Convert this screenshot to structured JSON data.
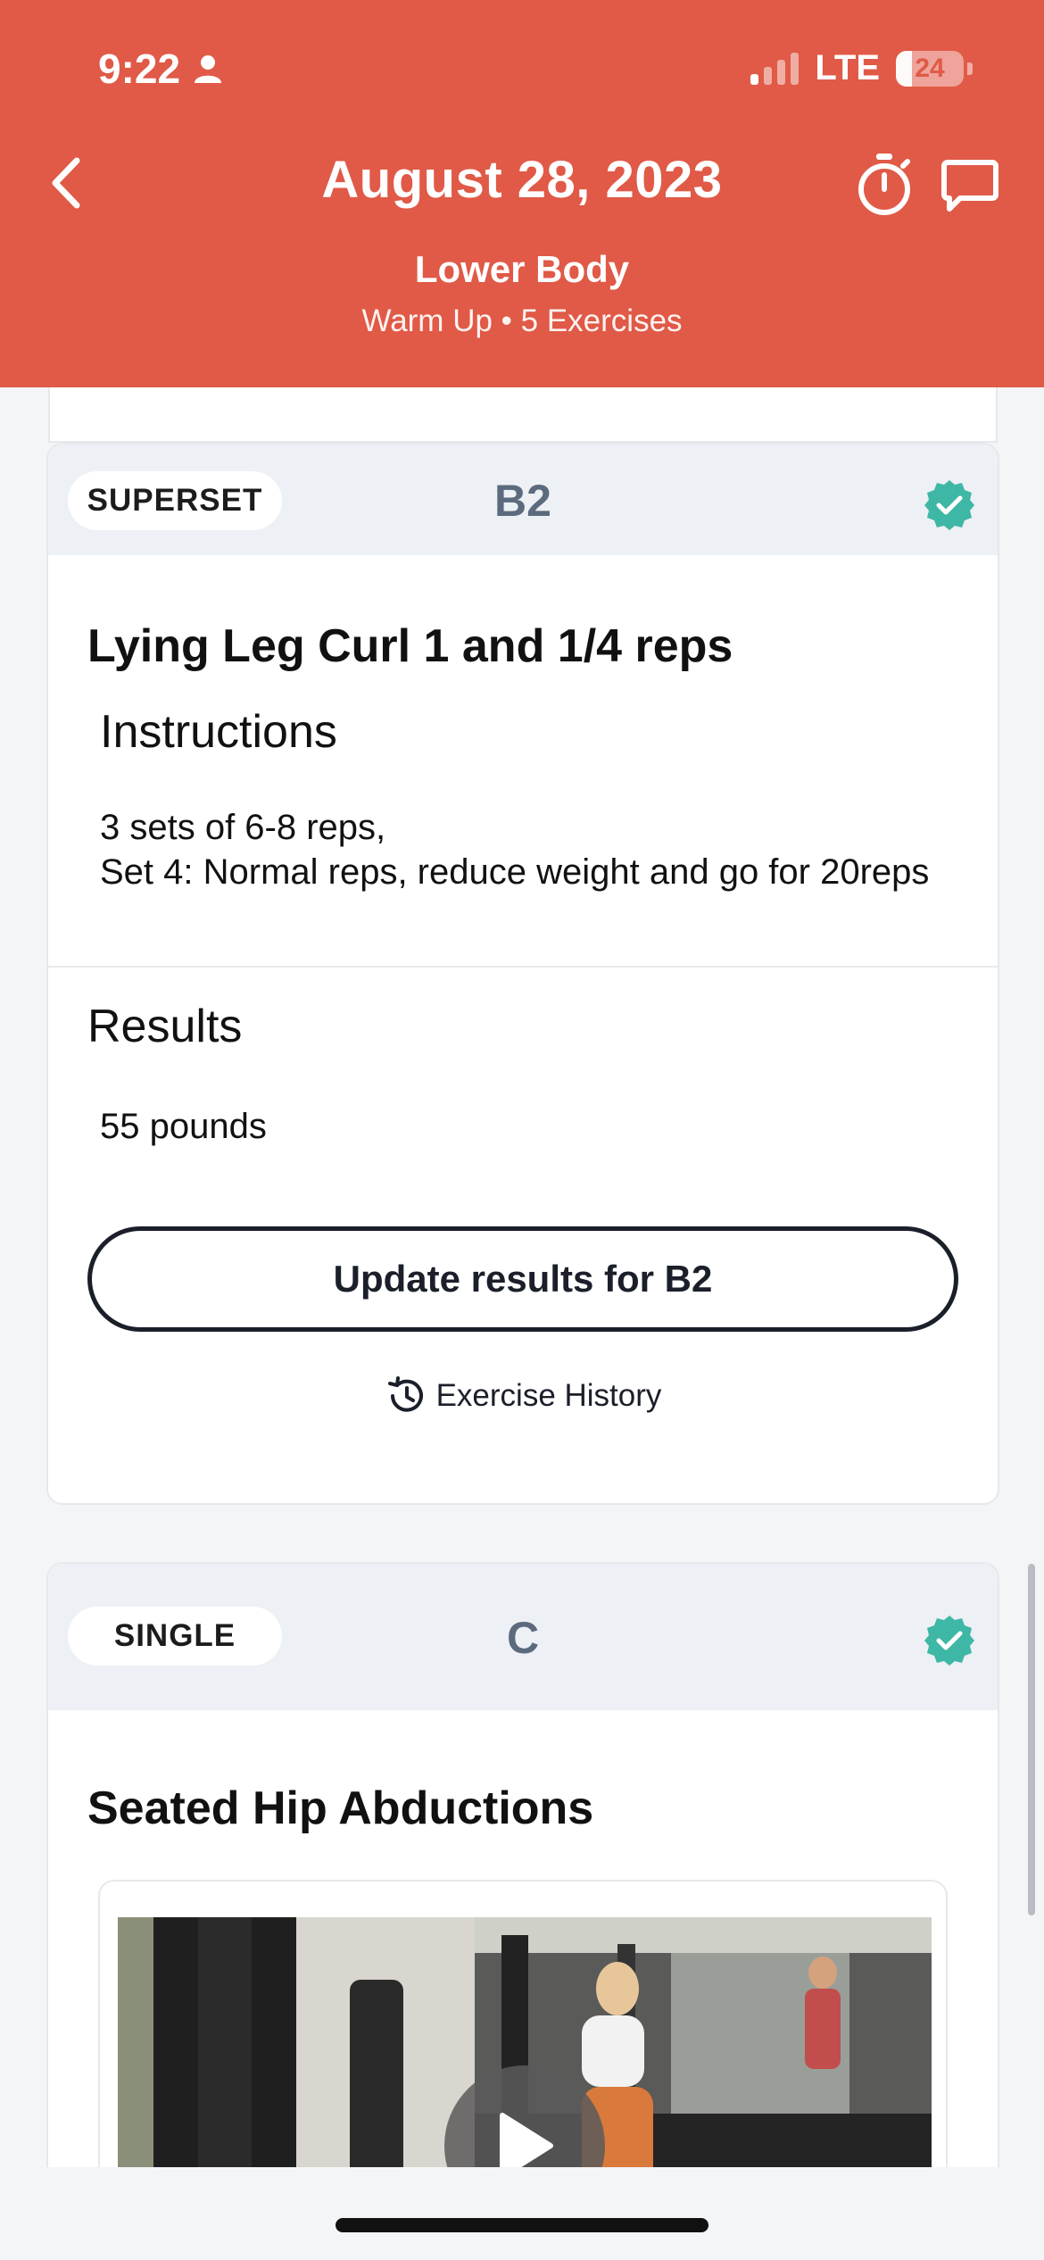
{
  "status_bar": {
    "time": "9:22",
    "network": "LTE",
    "battery": "24",
    "battery_level": 0.24,
    "signal_bars": 1
  },
  "header": {
    "title": "August 28, 2023",
    "subtitle": "Lower Body",
    "meta": "Warm Up • 5 Exercises",
    "back_icon": "chevron-left-icon",
    "timer_icon": "stopwatch-icon",
    "chat_icon": "chat-bubble-icon",
    "background": "#e05a47"
  },
  "exercises": [
    {
      "type": "SUPERSET",
      "group": "B2",
      "completed": true,
      "name": "Lying Leg Curl 1 and 1/4 reps",
      "instructions_heading": "Instructions",
      "instructions": "3 sets of 6-8 reps,\nSet 4: Normal reps, reduce weight and go for 20reps",
      "results_heading": "Results",
      "result_value": "55 pounds",
      "update_button": "Update results for B2",
      "history_link": "Exercise History"
    },
    {
      "type": "SINGLE",
      "group": "C",
      "completed": true,
      "name": "Seated Hip Abductions",
      "video_icon": "play-icon"
    }
  ],
  "colors": {
    "accent": "#e05a47",
    "check": "#3fb7a6",
    "band": "#edf0f4",
    "group_label": "#5b6a7d"
  }
}
